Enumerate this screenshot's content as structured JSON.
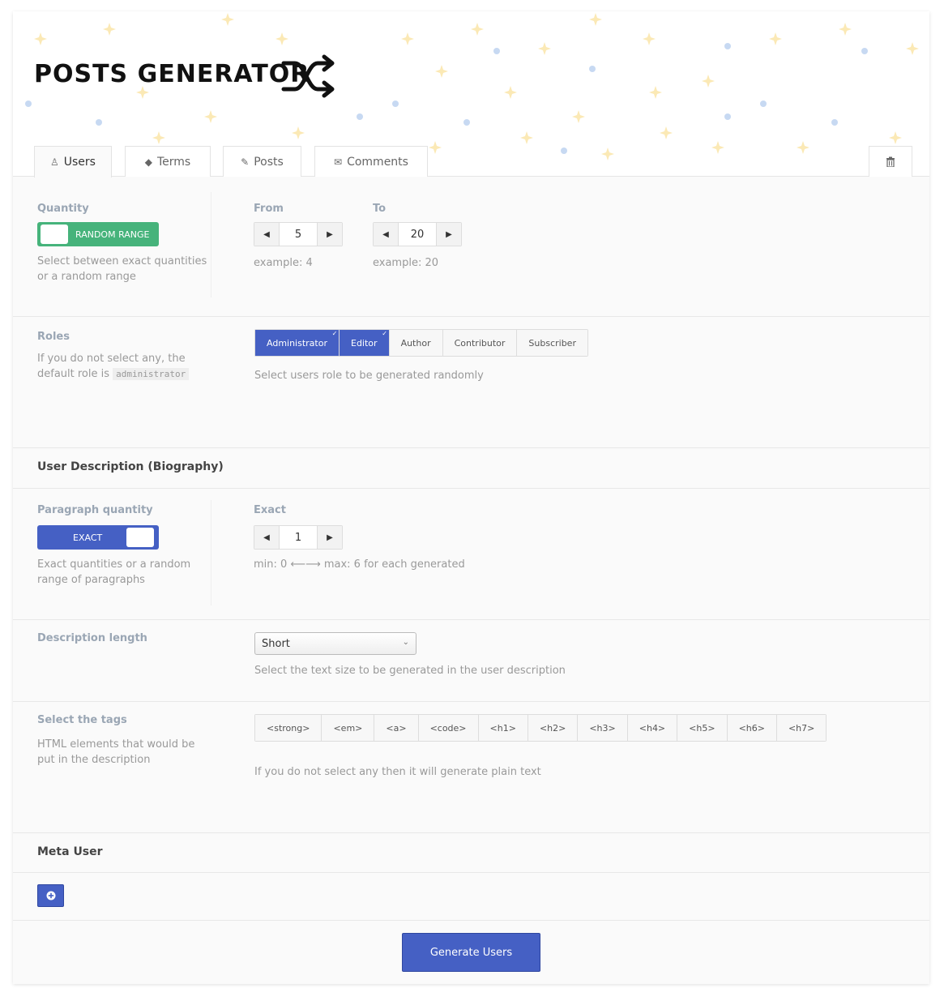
{
  "brand": {
    "title": "POSTS GENERATOR",
    "icon": "shuffle-icon"
  },
  "tabs": [
    {
      "label": "Users",
      "icon": "user-icon"
    },
    {
      "label": "Terms",
      "icon": "tags-icon"
    },
    {
      "label": "Posts",
      "icon": "edit-icon"
    },
    {
      "label": "Comments",
      "icon": "comments-icon"
    }
  ],
  "trash_icon": "trash-icon",
  "quantity": {
    "label": "Quantity",
    "toggle_label": "RANDOM RANGE",
    "help": "Select between exact quantities or a random range",
    "from_label": "From",
    "from_value": "5",
    "from_example": "example: 4",
    "to_label": "To",
    "to_value": "20",
    "to_example": "example: 20"
  },
  "roles": {
    "label": "Roles",
    "help_prefix": "If you do not select any, the default role is",
    "default_role": "administrator",
    "options": [
      {
        "label": "Administrator",
        "selected": true
      },
      {
        "label": "Editor",
        "selected": true
      },
      {
        "label": "Author",
        "selected": false
      },
      {
        "label": "Contributor",
        "selected": false
      },
      {
        "label": "Subscriber",
        "selected": false
      }
    ],
    "note": "Select users role to be generated randomly"
  },
  "bio": {
    "heading": "User Description (Biography)",
    "para_label": "Paragraph quantity",
    "toggle_label": "EXACT",
    "para_help": "Exact quantities or a random range of paragraphs",
    "exact_label": "Exact",
    "exact_value": "1",
    "exact_note": "min: 0 ⟵⟶ max: 6 for each generated"
  },
  "desc_length": {
    "label": "Description length",
    "selected": "Short",
    "note": "Select the text size to be generated in the user description"
  },
  "tags": {
    "label": "Select the tags",
    "help": "HTML elements that would be put in the description",
    "options": [
      "<strong>",
      "<em>",
      "<a>",
      "<code>",
      "<h1>",
      "<h2>",
      "<h3>",
      "<h4>",
      "<h5>",
      "<h6>",
      "<h7>"
    ],
    "note": "If you do not select any then it will generate plain text"
  },
  "meta": {
    "heading": "Meta User",
    "add_icon": "plus-circle-icon"
  },
  "actions": {
    "generate_label": "Generate Users"
  },
  "colors": {
    "primary": "#4560c4",
    "success": "#46b37b"
  }
}
